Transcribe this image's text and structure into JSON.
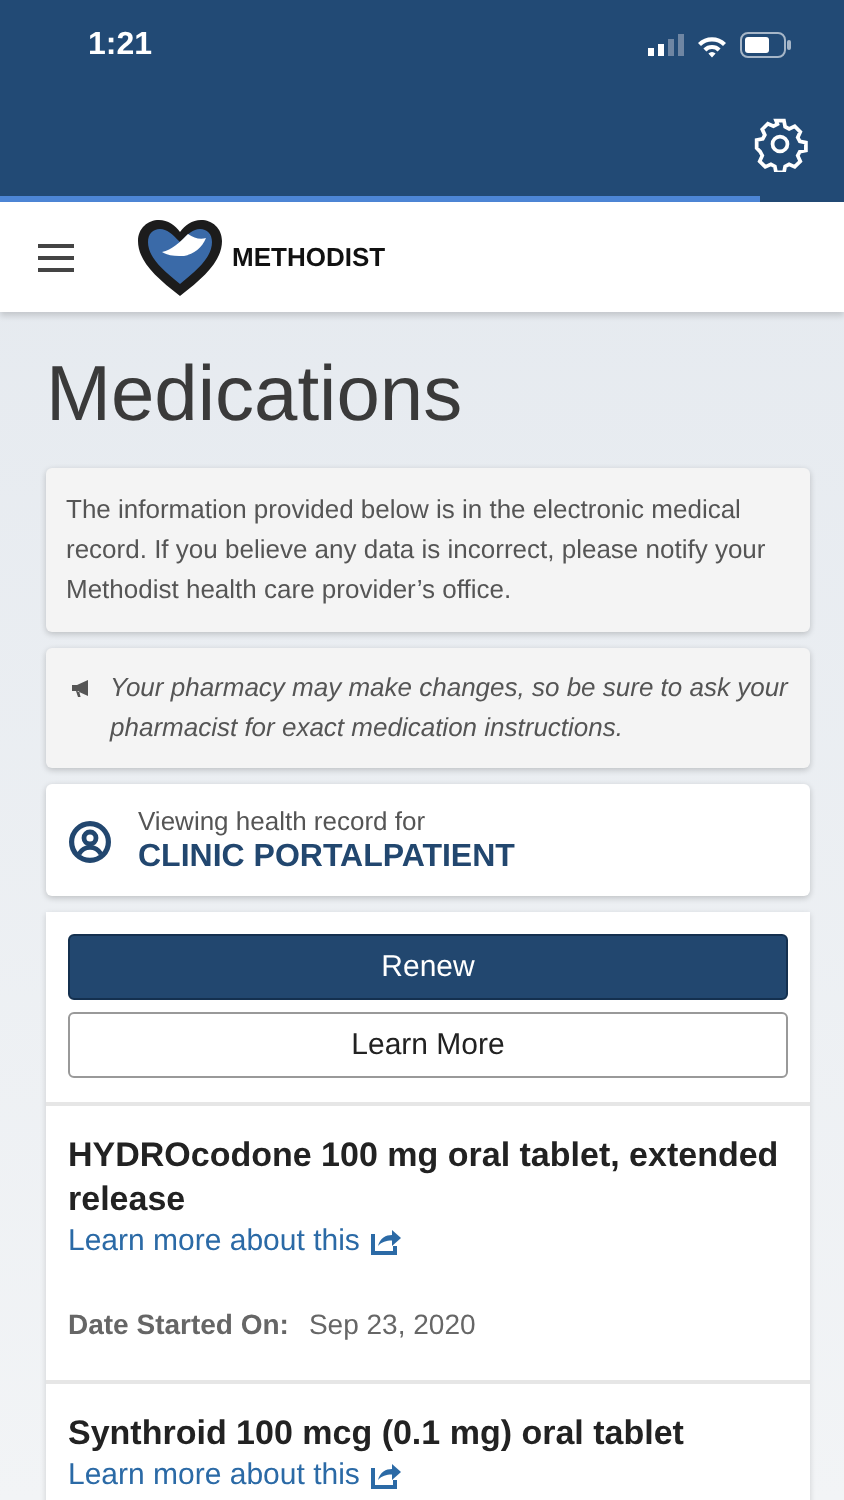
{
  "status_bar": {
    "time": "1:21"
  },
  "loading": {
    "level": 0.9
  },
  "header": {
    "brand": "METHODIST"
  },
  "page": {
    "title": "Medications"
  },
  "notice": "The information provided below is in the electronic medical record. If you believe any data is incorrect, please notify your Methodist health care provider’s office.",
  "tip": "Your pharmacy may make changes, so be sure to ask your pharmacist for exact medication instructions.",
  "patient": {
    "caption": "Viewing health record for",
    "name": "CLINIC PORTALPATIENT"
  },
  "buttons": [
    {
      "label": "Renew",
      "kind": "primary"
    },
    {
      "label": "Learn More",
      "kind": "secondary"
    }
  ],
  "medications": [
    {
      "name": "HYDROcodone 100 mg oral tablet, extended release",
      "link": "Learn more about this",
      "date_label": "Date Started On:",
      "date": "Sep 23, 2020"
    },
    {
      "name": "Synthroid 100 mcg (0.1 mg) oral tablet",
      "link": "Learn more about this"
    }
  ]
}
